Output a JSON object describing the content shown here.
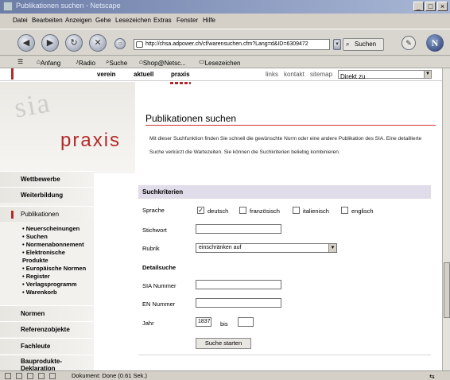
{
  "window": {
    "title": "Publikationen suchen - Netscape"
  },
  "menu": [
    "Datei",
    "Bearbeiten",
    "Anzeigen",
    "Gehe",
    "Lesezeichen",
    "Extras",
    "Fenster",
    "Hilfe"
  ],
  "navbar": {
    "url": "http://chsa.adpower.ch/cf/warensuchen.cfm?Lang=d&ID=6309472",
    "search_label": "Suchen"
  },
  "personal_toolbar": {
    "items": [
      "Anfang",
      "Radio",
      "Suche",
      "Shop@Netsc...",
      "Lesezeichen"
    ]
  },
  "site_nav": {
    "items": [
      "verein",
      "aktuell",
      "praxis"
    ],
    "right_links": [
      "links",
      "kontakt",
      "sitemap"
    ],
    "lang_select": "Direkt zu"
  },
  "left": {
    "logo_sia": "sia",
    "logo_praxis": "praxis",
    "nav_top": [
      "Wettbewerbe",
      "Weiterbildung",
      "Publikationen"
    ],
    "sub_items": [
      "• Neuerscheinungen",
      "• Suchen",
      "• Normenabonnement",
      "• Elektronische",
      "  Produkte",
      "• Europäische Normen",
      "• Register",
      "• Verlagsprogramm",
      "• Warenkorb"
    ],
    "nav_bottom": [
      "Normen",
      "Referenzobjekte",
      "Fachleute",
      "Bauprodukte-Deklaration"
    ]
  },
  "content": {
    "title": "Publikationen suchen",
    "intro": "Mit dieser Suchfunktion finden Sie schnell die gewünschte Norm oder eine andere Publikation des SIA. Eine detaillierte Suche verkürzt die Wartezeiten. Sie können die Suchkriterien beliebig kombinieren.",
    "criteria_heading": "Suchkriterien",
    "sprache_label": "Sprache",
    "languages": [
      {
        "label": "deutsch",
        "checked": true
      },
      {
        "label": "französisch",
        "checked": false
      },
      {
        "label": "italienisch",
        "checked": false
      },
      {
        "label": "englisch",
        "checked": false
      }
    ],
    "stichwort_label": "Stichwort",
    "rubrik_label": "Rubrik",
    "rubrik_value": "einschränken auf",
    "detail_heading": "Detailsuche",
    "sia_label": "SIA Nummer",
    "en_label": "EN Nummer",
    "jahr_label": "Jahr",
    "jahr_from": "1837",
    "bis_label": "bis",
    "jahr_to": "",
    "submit_label": "Suche starten"
  },
  "status": {
    "text": "Dokument: Done (0.61 Sek.)"
  }
}
